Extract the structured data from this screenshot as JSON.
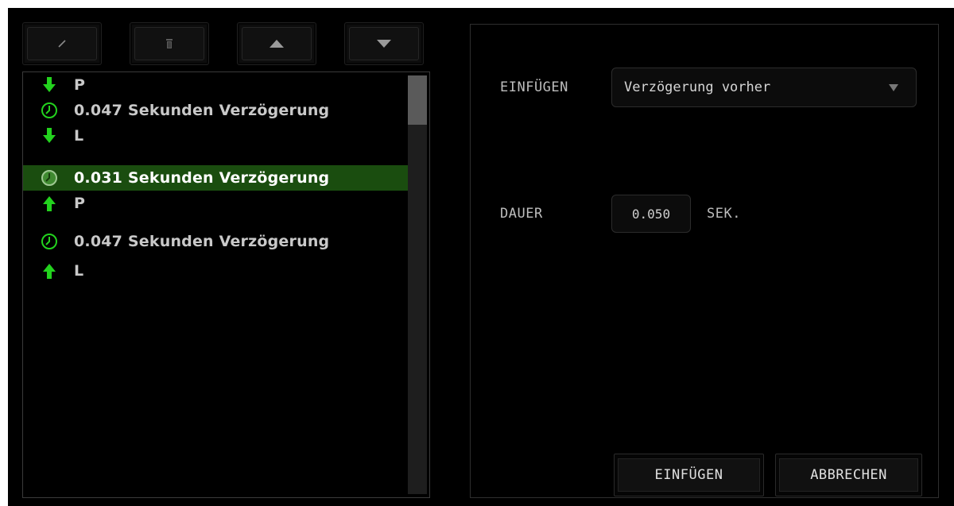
{
  "toolbar": {
    "buttons": [
      {
        "name": "edit-button",
        "icon": "pencil-icon"
      },
      {
        "name": "delete-button",
        "icon": "trash-icon"
      },
      {
        "name": "move-up-button",
        "icon": "triangle-up-icon"
      },
      {
        "name": "move-down-button",
        "icon": "triangle-down-icon"
      }
    ]
  },
  "macro_list": {
    "items": [
      {
        "type": "key-down",
        "label": "P",
        "icon": "arrow-down-icon",
        "selected": false
      },
      {
        "type": "delay",
        "label": "0.047 Sekunden Verzögerung",
        "icon": "clock-icon",
        "selected": false
      },
      {
        "type": "key-down",
        "label": "L",
        "icon": "arrow-down-icon",
        "selected": false
      },
      {
        "type": "delay",
        "label": "0.031 Sekunden Verzögerung",
        "icon": "clock-icon",
        "selected": true
      },
      {
        "type": "key-up",
        "label": "P",
        "icon": "arrow-up-icon",
        "selected": false
      },
      {
        "type": "delay",
        "label": "0.047 Sekunden Verzögerung",
        "icon": "clock-icon",
        "selected": false
      },
      {
        "type": "key-up",
        "label": "L",
        "icon": "arrow-up-icon",
        "selected": false
      }
    ]
  },
  "insert_panel": {
    "insert_label": "EINFÜGEN",
    "insert_option": "Verzögerung vorher",
    "duration_label": "DAUER",
    "duration_value": "0.050",
    "duration_unit": "SEK.",
    "confirm_label": "EINFÜGEN",
    "cancel_label": "ABBRECHEN"
  },
  "colors": {
    "accent": "#23d21e",
    "selected_row": "#1a4d0f",
    "background": "#000000"
  }
}
